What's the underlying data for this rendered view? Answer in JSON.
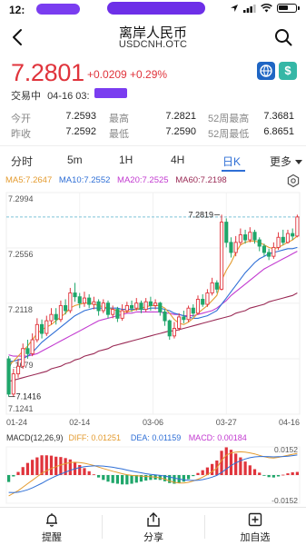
{
  "status_bar": {
    "time": "12:",
    "icons": [
      "location-arrow-icon",
      "signal-icon",
      "wifi-icon",
      "battery-icon"
    ]
  },
  "nav": {
    "title": "离岸人民币",
    "subtitle": "USDCNH.OTC"
  },
  "quote": {
    "price": "7.2801",
    "change": "+0.0209 +0.29%",
    "status": "交易中",
    "time": "04-16 03:",
    "up_color": "#e0343c"
  },
  "stats": [
    {
      "label": "今开",
      "value": "7.2593"
    },
    {
      "label": "最高",
      "value": "7.2821"
    },
    {
      "label": "52周最高",
      "value": "7.3681"
    },
    {
      "label": "昨收",
      "value": "7.2592"
    },
    {
      "label": "最低",
      "value": "7.2590"
    },
    {
      "label": "52周最低",
      "value": "6.8651"
    }
  ],
  "tabs": [
    "分时",
    "5m",
    "1H",
    "4H",
    "日K",
    "更多"
  ],
  "active_tab": "日K",
  "ma_legend": {
    "ma5": "MA5:7.2647",
    "ma10": "MA10:7.2552",
    "ma20": "MA20:7.2525",
    "ma60": "MA60:7.2198"
  },
  "bottom_bar": {
    "remind": "提醒",
    "share": "分享",
    "watch": "加自选"
  },
  "chart_data": {
    "type": "candlestick",
    "y_axis_labels": [
      "7.2994",
      "7.2556",
      "7.2118",
      "7.1679",
      "7.1241"
    ],
    "ylim": [
      7.1241,
      7.2994
    ],
    "x_axis_labels": [
      "01-24",
      "02-14",
      "03-06",
      "03-27",
      "04-16"
    ],
    "high_annotation": "7.2819",
    "low_annotation": "7.1416",
    "reference_price": 7.2801,
    "up_color": "#e0343c",
    "down_color": "#1fa66a",
    "candles": [
      [
        7.1679,
        7.14,
        7.17,
        7.138
      ],
      [
        7.14,
        7.156,
        7.16,
        7.138
      ],
      [
        7.156,
        7.162,
        7.168,
        7.153
      ],
      [
        7.162,
        7.176,
        7.18,
        7.16
      ],
      [
        7.176,
        7.172,
        7.183,
        7.168
      ],
      [
        7.172,
        7.183,
        7.188,
        7.17
      ],
      [
        7.183,
        7.195,
        7.2,
        7.181
      ],
      [
        7.195,
        7.188,
        7.199,
        7.184
      ],
      [
        7.188,
        7.198,
        7.202,
        7.186
      ],
      [
        7.198,
        7.203,
        7.208,
        7.195
      ],
      [
        7.203,
        7.199,
        7.208,
        7.195
      ],
      [
        7.199,
        7.21,
        7.214,
        7.197
      ],
      [
        7.21,
        7.206,
        7.215,
        7.203
      ],
      [
        7.206,
        7.22,
        7.224,
        7.204
      ],
      [
        7.22,
        7.217,
        7.228,
        7.213
      ],
      [
        7.217,
        7.212,
        7.22,
        7.208
      ],
      [
        7.212,
        7.216,
        7.221,
        7.209
      ],
      [
        7.216,
        7.211,
        7.219,
        7.208
      ],
      [
        7.211,
        7.213,
        7.217,
        7.207
      ],
      [
        7.213,
        7.206,
        7.215,
        7.202
      ],
      [
        7.206,
        7.212,
        7.215,
        7.204
      ],
      [
        7.212,
        7.203,
        7.214,
        7.2
      ],
      [
        7.203,
        7.207,
        7.21,
        7.2
      ],
      [
        7.207,
        7.2,
        7.209,
        7.197
      ],
      [
        7.2,
        7.206,
        7.211,
        7.198
      ],
      [
        7.206,
        7.21,
        7.213,
        7.204
      ],
      [
        7.21,
        7.208,
        7.214,
        7.205
      ],
      [
        7.208,
        7.212,
        7.216,
        7.206
      ],
      [
        7.212,
        7.207,
        7.214,
        7.204
      ],
      [
        7.207,
        7.213,
        7.216,
        7.205
      ],
      [
        7.213,
        7.21,
        7.217,
        7.206
      ],
      [
        7.21,
        7.212,
        7.215,
        7.207
      ],
      [
        7.212,
        7.205,
        7.213,
        7.202
      ],
      [
        7.205,
        7.198,
        7.207,
        7.194
      ],
      [
        7.198,
        7.186,
        7.199,
        7.183
      ],
      [
        7.186,
        7.192,
        7.197,
        7.184
      ],
      [
        7.192,
        7.201,
        7.204,
        7.19
      ],
      [
        7.201,
        7.199,
        7.206,
        7.196
      ],
      [
        7.199,
        7.208,
        7.21,
        7.197
      ],
      [
        7.208,
        7.204,
        7.211,
        7.201
      ],
      [
        7.204,
        7.215,
        7.218,
        7.203
      ],
      [
        7.215,
        7.211,
        7.219,
        7.209
      ],
      [
        7.211,
        7.22,
        7.223,
        7.209
      ],
      [
        7.22,
        7.228,
        7.232,
        7.218
      ],
      [
        7.228,
        7.223,
        7.23,
        7.22
      ],
      [
        7.223,
        7.276,
        7.2819,
        7.222
      ],
      [
        7.276,
        7.26,
        7.279,
        7.256
      ],
      [
        7.26,
        7.252,
        7.264,
        7.248
      ],
      [
        7.252,
        7.26,
        7.265,
        7.249
      ],
      [
        7.26,
        7.266,
        7.271,
        7.258
      ],
      [
        7.266,
        7.262,
        7.27,
        7.259
      ],
      [
        7.262,
        7.268,
        7.272,
        7.26
      ],
      [
        7.268,
        7.262,
        7.27,
        7.259
      ],
      [
        7.262,
        7.257,
        7.264,
        7.253
      ],
      [
        7.257,
        7.252,
        7.259,
        7.249
      ],
      [
        7.252,
        7.249,
        7.255,
        7.246
      ],
      [
        7.249,
        7.256,
        7.26,
        7.247
      ],
      [
        7.256,
        7.264,
        7.268,
        7.254
      ],
      [
        7.264,
        7.26,
        7.27,
        7.258
      ],
      [
        7.26,
        7.267,
        7.27,
        7.259
      ],
      [
        7.267,
        7.265,
        7.271,
        7.262
      ],
      [
        7.265,
        7.2801,
        7.2819,
        7.264
      ]
    ],
    "ma5": [
      7.163,
      7.166,
      7.17,
      7.174,
      7.178,
      7.183,
      7.188,
      7.191,
      7.193,
      7.195,
      7.198,
      7.201,
      7.204,
      7.208,
      7.21,
      7.211,
      7.212,
      7.212,
      7.211,
      7.21,
      7.209,
      7.208,
      7.207,
      7.206,
      7.205,
      7.205,
      7.206,
      7.207,
      7.208,
      7.209,
      7.21,
      7.21,
      7.21,
      7.208,
      7.204,
      7.199,
      7.196,
      7.195,
      7.197,
      7.2,
      7.204,
      7.207,
      7.21,
      7.214,
      7.218,
      7.23,
      7.238,
      7.244,
      7.252,
      7.258,
      7.26,
      7.261,
      7.261,
      7.26,
      7.258,
      7.256,
      7.255,
      7.256,
      7.258,
      7.26,
      7.262,
      7.265
    ],
    "ma10": [
      7.166,
      7.166,
      7.167,
      7.168,
      7.17,
      7.173,
      7.177,
      7.181,
      7.184,
      7.187,
      7.19,
      7.193,
      7.196,
      7.199,
      7.202,
      7.204,
      7.206,
      7.207,
      7.208,
      7.208,
      7.208,
      7.208,
      7.208,
      7.208,
      7.207,
      7.207,
      7.207,
      7.207,
      7.207,
      7.207,
      7.208,
      7.208,
      7.208,
      7.207,
      7.206,
      7.204,
      7.203,
      7.202,
      7.201,
      7.2,
      7.2,
      7.201,
      7.202,
      7.204,
      7.206,
      7.211,
      7.216,
      7.221,
      7.226,
      7.231,
      7.236,
      7.24,
      7.244,
      7.247,
      7.249,
      7.251,
      7.252,
      7.253,
      7.254,
      7.255,
      7.255,
      7.256
    ],
    "ma20": [
      7.171,
      7.17,
      7.17,
      7.17,
      7.17,
      7.171,
      7.172,
      7.174,
      7.176,
      7.178,
      7.18,
      7.182,
      7.184,
      7.186,
      7.188,
      7.19,
      7.192,
      7.194,
      7.196,
      7.198,
      7.199,
      7.2,
      7.201,
      7.202,
      7.203,
      7.204,
      7.204,
      7.205,
      7.205,
      7.205,
      7.205,
      7.205,
      7.205,
      7.204,
      7.204,
      7.203,
      7.203,
      7.202,
      7.202,
      7.202,
      7.203,
      7.204,
      7.205,
      7.206,
      7.208,
      7.211,
      7.214,
      7.218,
      7.221,
      7.224,
      7.227,
      7.23,
      7.233,
      7.236,
      7.239,
      7.241,
      7.243,
      7.245,
      7.247,
      7.249,
      7.251,
      7.253
    ],
    "ma60": [
      7.15,
      7.151,
      7.152,
      7.153,
      7.154,
      7.155,
      7.156,
      7.157,
      7.158,
      7.16,
      7.161,
      7.162,
      7.164,
      7.165,
      7.167,
      7.168,
      7.17,
      7.171,
      7.172,
      7.174,
      7.175,
      7.176,
      7.178,
      7.179,
      7.18,
      7.181,
      7.182,
      7.183,
      7.184,
      7.185,
      7.186,
      7.187,
      7.188,
      7.189,
      7.19,
      7.19,
      7.191,
      7.192,
      7.193,
      7.194,
      7.195,
      7.196,
      7.197,
      7.198,
      7.199,
      7.2,
      7.201,
      7.202,
      7.204,
      7.205,
      7.206,
      7.208,
      7.209,
      7.21,
      7.211,
      7.213,
      7.214,
      7.215,
      7.216,
      7.217,
      7.218,
      7.22
    ],
    "macd_legend": {
      "label": "MACD(12,26,9)",
      "diff": "DIFF: 0.01251",
      "dea": "DEA: 0.01159",
      "macd": "MACD: 0.00184"
    },
    "macd_axis": [
      "0.0152",
      "-0.0152"
    ],
    "macd_range": [
      -0.0152,
      0.0152
    ],
    "diff": [
      -0.012,
      -0.0105,
      -0.009,
      -0.007,
      -0.005,
      -0.003,
      -0.001,
      0.001,
      0.0025,
      0.0038,
      0.0048,
      0.0058,
      0.0066,
      0.0072,
      0.0074,
      0.0072,
      0.0068,
      0.0062,
      0.0055,
      0.0046,
      0.0038,
      0.003,
      0.0022,
      0.0015,
      0.0008,
      0.0002,
      -0.0002,
      -0.0004,
      -0.0006,
      -0.0008,
      -0.001,
      -0.0012,
      -0.0016,
      -0.0024,
      -0.0034,
      -0.0042,
      -0.0046,
      -0.0046,
      -0.0042,
      -0.0034,
      -0.0024,
      -0.0012,
      0.0002,
      0.002,
      0.004,
      0.0085,
      0.0115,
      0.0128,
      0.0132,
      0.0134,
      0.0132,
      0.0128,
      0.0122,
      0.0114,
      0.0106,
      0.01,
      0.0098,
      0.0102,
      0.0108,
      0.0114,
      0.012,
      0.0125
    ],
    "dea": [
      -0.01,
      -0.0101,
      -0.0099,
      -0.0093,
      -0.0085,
      -0.0074,
      -0.0061,
      -0.0047,
      -0.0032,
      -0.0018,
      -0.0005,
      0.0006,
      0.0017,
      0.0027,
      0.0036,
      0.0043,
      0.0048,
      0.0051,
      0.0053,
      0.0053,
      0.0052,
      0.0049,
      0.0045,
      0.004,
      0.0035,
      0.0029,
      0.0023,
      0.0018,
      0.0013,
      0.0008,
      0.0004,
      0.0001,
      -0.0002,
      -0.0006,
      -0.0011,
      -0.0017,
      -0.0023,
      -0.0027,
      -0.003,
      -0.0031,
      -0.003,
      -0.0026,
      -0.002,
      -0.0012,
      -0.0002,
      0.0015,
      0.0035,
      0.0055,
      0.007,
      0.0083,
      0.0093,
      0.01,
      0.0105,
      0.0107,
      0.0107,
      0.0106,
      0.0105,
      0.0106,
      0.0107,
      0.0109,
      0.0112,
      0.0116
    ]
  }
}
